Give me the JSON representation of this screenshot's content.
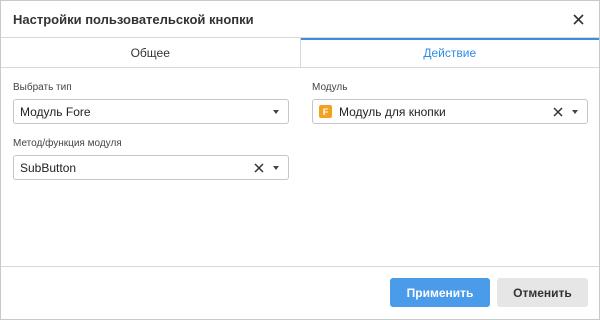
{
  "dialog": {
    "title": "Настройки пользовательской кнопки"
  },
  "tabs": [
    {
      "label": "Общее",
      "active": false
    },
    {
      "label": "Действие",
      "active": true
    }
  ],
  "fields": {
    "type": {
      "label": "Выбрать тип",
      "value": "Модуль Fore"
    },
    "module": {
      "label": "Модуль",
      "value": "Модуль для кнопки",
      "icon": "F"
    },
    "method": {
      "label": "Метод/функция модуля",
      "value": "SubButton"
    }
  },
  "footer": {
    "apply_label": "Применить",
    "cancel_label": "Отменить"
  },
  "colors": {
    "accent": "#2e8be6",
    "apply_bg": "#4a9be9",
    "cancel_bg": "#e6e6e6",
    "module_icon": "#f3a21f"
  }
}
